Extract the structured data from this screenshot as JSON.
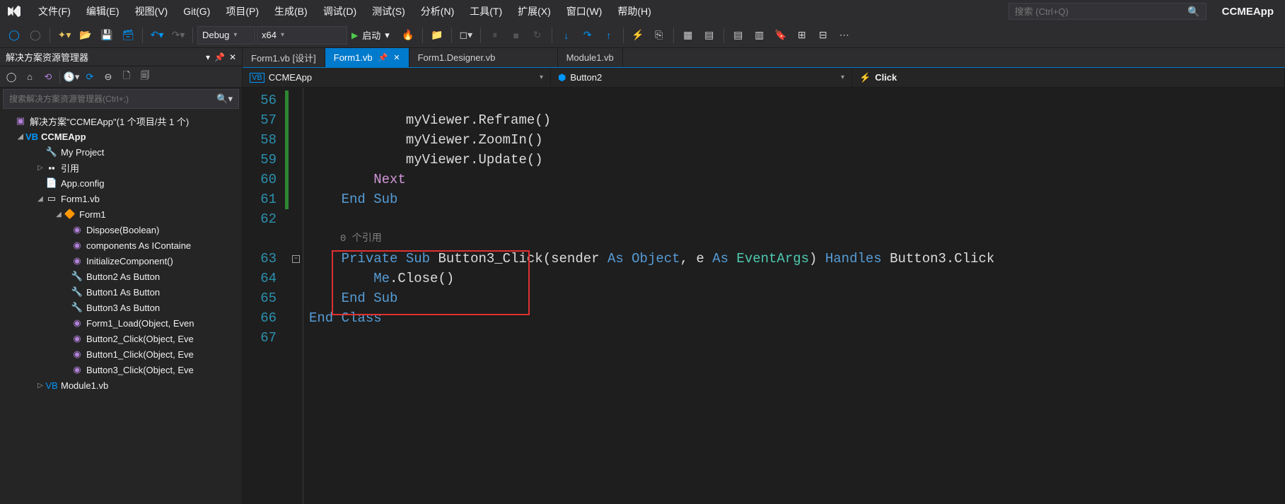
{
  "app_title": "CCMEApp",
  "menubar": {
    "file": "文件(F)",
    "edit": "编辑(E)",
    "view": "视图(V)",
    "git": "Git(G)",
    "project": "项目(P)",
    "build": "生成(B)",
    "debug": "调试(D)",
    "test": "测试(S)",
    "analyze": "分析(N)",
    "tools": "工具(T)",
    "extensions": "扩展(X)",
    "window": "窗口(W)",
    "help": "帮助(H)"
  },
  "search_placeholder": "搜索 (Ctrl+Q)",
  "toolbar": {
    "configuration": "Debug",
    "platform": "x64",
    "start_label": "启动"
  },
  "solution_explorer": {
    "title": "解决方案资源管理器",
    "search_placeholder": "搜索解决方案资源管理器(Ctrl+;)",
    "solution_label": "解决方案\"CCMEApp\"(1 个项目/共 1 个)",
    "project": "CCMEApp",
    "items": {
      "my_project": "My Project",
      "references": "引用",
      "app_config": "App.config",
      "form1_vb": "Form1.vb",
      "form1": "Form1",
      "dispose": "Dispose(Boolean)",
      "components": "components As IContaine",
      "init_component": "InitializeComponent()",
      "button2": "Button2 As Button",
      "button1": "Button1 As Button",
      "button3": "Button3 As Button",
      "form1_load": "Form1_Load(Object, Even",
      "button2_click": "Button2_Click(Object, Eve",
      "button1_click": "Button1_Click(Object, Eve",
      "button3_click": "Button3_Click(Object, Eve",
      "module1": "Module1.vb"
    }
  },
  "tabs": {
    "form1_design": "Form1.vb [设计]",
    "form1_vb": "Form1.vb",
    "form1_designer": "Form1.Designer.vb",
    "module1": "Module1.vb"
  },
  "navbar": {
    "project": "CCMEApp",
    "object": "Button2",
    "event": "Click"
  },
  "code": {
    "line_numbers": [
      "56",
      "57",
      "58",
      "59",
      "60",
      "61",
      "62",
      "",
      "63",
      "64",
      "65",
      "66",
      "67"
    ],
    "codelens": "0 个引用",
    "l57": "            myViewer.Reframe()",
    "l58": "            myViewer.ZoomIn()",
    "l59": "            myViewer.Update()",
    "l60_next": "Next",
    "l61_endsub": "End Sub",
    "l63_private": "Private",
    "l63_sub": "Sub",
    "l63_name": "Button3_Click",
    "l63_sender": "sender",
    "l63_as1": "As",
    "l63_object": "Object",
    "l63_e": "e",
    "l63_as2": "As",
    "l63_eventargs": "EventArgs",
    "l63_handles": "Handles",
    "l63_btn3click": "Button3.Click",
    "l64_me": "Me",
    "l64_close": ".Close()",
    "l65_endsub": "End Sub",
    "l66_end": "End",
    "l66_class": "Class"
  }
}
